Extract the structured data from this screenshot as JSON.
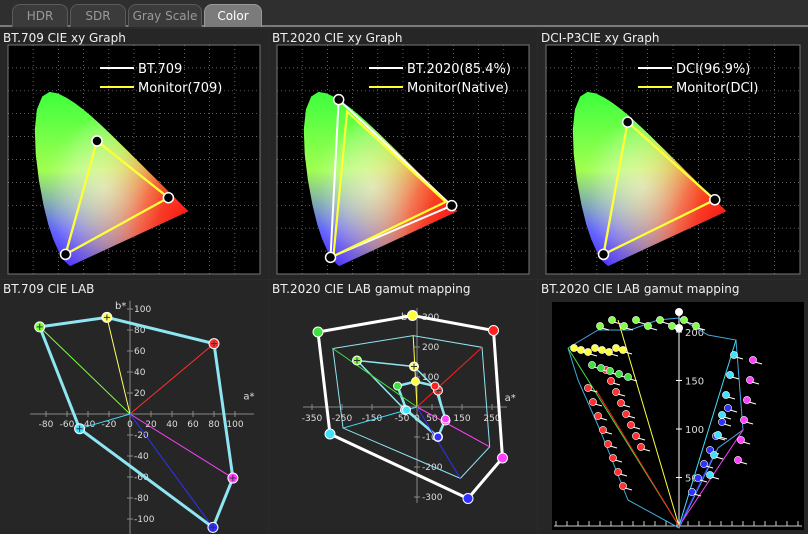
{
  "tabs": [
    {
      "label": "HDR",
      "active": false
    },
    {
      "label": "SDR",
      "active": false
    },
    {
      "label": "Gray Scale",
      "active": false
    },
    {
      "label": "Color",
      "active": true
    }
  ],
  "colors": {
    "reference": "#ffffff",
    "measured": "#ffff33",
    "grid": "#8a8a8a",
    "accent_cyan": "#8ee6f2"
  },
  "panels": {
    "xy": [
      {
        "title": "BT.709 CIE xy Graph",
        "legend_ref": "BT.709",
        "legend_meas": "Monitor(709)",
        "ref": [
          [
            0.64,
            0.33
          ],
          [
            0.3,
            0.6
          ],
          [
            0.15,
            0.06
          ]
        ],
        "meas": [
          [
            0.64,
            0.33
          ],
          [
            0.3,
            0.6
          ],
          [
            0.15,
            0.06
          ]
        ]
      },
      {
        "title": "BT.2020 CIE xy Graph",
        "legend_ref": "BT.2020(85.4%)",
        "legend_meas": "Monitor(Native)",
        "ref": [
          [
            0.708,
            0.292
          ],
          [
            0.17,
            0.797
          ],
          [
            0.131,
            0.046
          ]
        ],
        "meas": [
          [
            0.68,
            0.31
          ],
          [
            0.21,
            0.74
          ],
          [
            0.145,
            0.052
          ]
        ]
      },
      {
        "title": "DCI-P3CIE  xy Graph",
        "legend_ref": "DCI(96.9%)",
        "legend_meas": "Monitor(DCI)",
        "ref": [
          [
            0.68,
            0.32
          ],
          [
            0.265,
            0.69
          ],
          [
            0.15,
            0.06
          ]
        ],
        "meas": [
          [
            0.68,
            0.32
          ],
          [
            0.265,
            0.69
          ],
          [
            0.15,
            0.06
          ]
        ]
      }
    ],
    "lab1": {
      "title": "BT.709 CIE LAB",
      "a_label": "a*",
      "b_label": "b*",
      "a_ticks": [
        "-80",
        "-60",
        "-40",
        "-20",
        "0",
        "20",
        "40",
        "60",
        "80",
        "100"
      ],
      "b_ticks": [
        "100",
        "80",
        "60",
        "40",
        "20",
        "0",
        "-20",
        "-40",
        "-60",
        "-80",
        "-100",
        "-120"
      ]
    },
    "lab2": {
      "title": "BT.2020 CIE LAB gamut mapping",
      "a_label": "a*",
      "b_label": "b*",
      "a_ticks": [
        "-350",
        "-250",
        "-150",
        "-50",
        "0",
        "50",
        "150",
        "250"
      ],
      "b_ticks": [
        "300",
        "200",
        "100",
        "-100",
        "-200",
        "-300"
      ]
    },
    "lab3": {
      "title": "BT.2020 CIE LAB gamut mapping",
      "l_ticks": [
        "200",
        "150",
        "100",
        "50"
      ]
    }
  }
}
